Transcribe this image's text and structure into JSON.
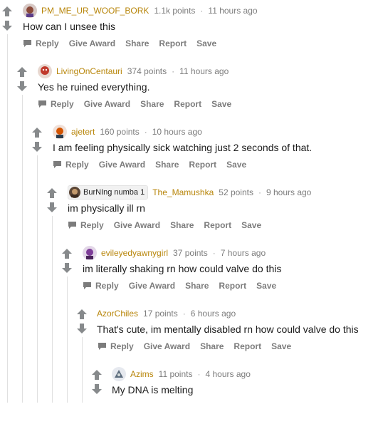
{
  "actions": {
    "reply": "Reply",
    "give_award": "Give Award",
    "share": "Share",
    "report": "Report",
    "save": "Save"
  },
  "colors": {
    "username": "#b8860b",
    "meta": "#7c7c7c",
    "arrow": "#878a8c",
    "thread_line": "#e0e0e0"
  },
  "comments": [
    {
      "username": "PM_ME_UR_WOOF_BORK",
      "points": "1.1k points",
      "time": "11 hours ago",
      "body": "How can I unsee this",
      "avatar_icon": "avatar-snoo-icon"
    },
    {
      "username": "LivingOnCentauri",
      "points": "374 points",
      "time": "11 hours ago",
      "body": "Yes he ruined everything.",
      "avatar_icon": "avatar-snoo-icon"
    },
    {
      "username": "ajetert",
      "points": "160 points",
      "time": "10 hours ago",
      "body": "I am feeling physically sick watching just 2 seconds of that.",
      "avatar_icon": "avatar-snoo-icon"
    },
    {
      "flair": "BurNIng numba 1",
      "username": "The_Mamushka",
      "points": "52 points",
      "time": "9 hours ago",
      "body": "im physically ill rn",
      "avatar_icon": "flair-avatar-icon"
    },
    {
      "username": "evileyedyawnygirl",
      "points": "37 points",
      "time": "7 hours ago",
      "body": "im literally shaking rn how could valve do this",
      "avatar_icon": "avatar-snoo-icon"
    },
    {
      "username": "AzorChiles",
      "points": "17 points",
      "time": "6 hours ago",
      "body": "That's cute, im mentally disabled rn how could valve do this"
    },
    {
      "username": "Azims",
      "points": "11 points",
      "time": "4 hours ago",
      "body": "My DNA is melting",
      "avatar_icon": "avatar-snoo-icon"
    }
  ]
}
